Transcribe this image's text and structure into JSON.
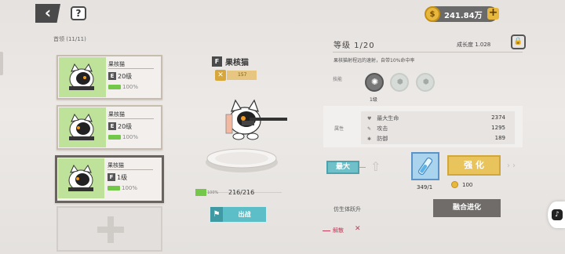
{
  "topbar": {
    "back_icon": "chevron-left-icon",
    "help_icon": "question-book-icon",
    "help_glyph": "?",
    "currency": {
      "value": "241.84万",
      "icon": "coin-icon",
      "icon_glyph": "$",
      "add_label": "+"
    }
  },
  "roster": {
    "label": "首领 (11/11)",
    "cards": [
      {
        "name": "果核猫",
        "rank": "E",
        "level": "20级",
        "hp": "100%"
      },
      {
        "name": "果核猫",
        "rank": "E",
        "level": "20级",
        "hp": "100%"
      },
      {
        "name": "果核猫",
        "rank": "F",
        "level": "1级",
        "hp": "100%"
      }
    ],
    "add_slot_icon": "plus-icon"
  },
  "hero": {
    "rank": "F",
    "name": "果核猫",
    "power_icon_glyph": "✕",
    "power": "157",
    "hp_percent": "100%",
    "hp_value": "216/216",
    "deploy_label": "出战"
  },
  "detail": {
    "level_title": "等级  1/20",
    "growth_label": "成长度  1.028",
    "description": "果核猫射程远的速射，自带10%命中率",
    "skill_label": "技能",
    "skill_1_glyph": "✺",
    "skill_1_level": "1级",
    "lock_glyph": "⬢",
    "attr_label": "属性",
    "stats": [
      {
        "icon": "heart-icon",
        "glyph": "♥",
        "label": "最大生命",
        "value": "2374"
      },
      {
        "icon": "sword-icon",
        "glyph": "✎",
        "label": "攻击",
        "value": "1295"
      },
      {
        "icon": "shield-icon",
        "glyph": "✱",
        "label": "防御",
        "value": "189"
      }
    ],
    "max_label": "最大",
    "upgrade_glyph": "⇧",
    "item_count": "349/1",
    "enhance_label": "强 化",
    "enhance_cost": "100",
    "chevron_glyph": "›",
    "evolve_label": "仿生体跃升",
    "merge_label": "融合进化",
    "dismiss_label": "解散",
    "dismiss_glyph": "✕"
  },
  "side_button_glyph": "♪",
  "colors": {
    "accent_teal": "#5cbfc8",
    "accent_gold": "#e9c35b",
    "hp_green": "#74c849",
    "card_art_green": "#bfe29a",
    "danger_red": "#c63a5a"
  }
}
